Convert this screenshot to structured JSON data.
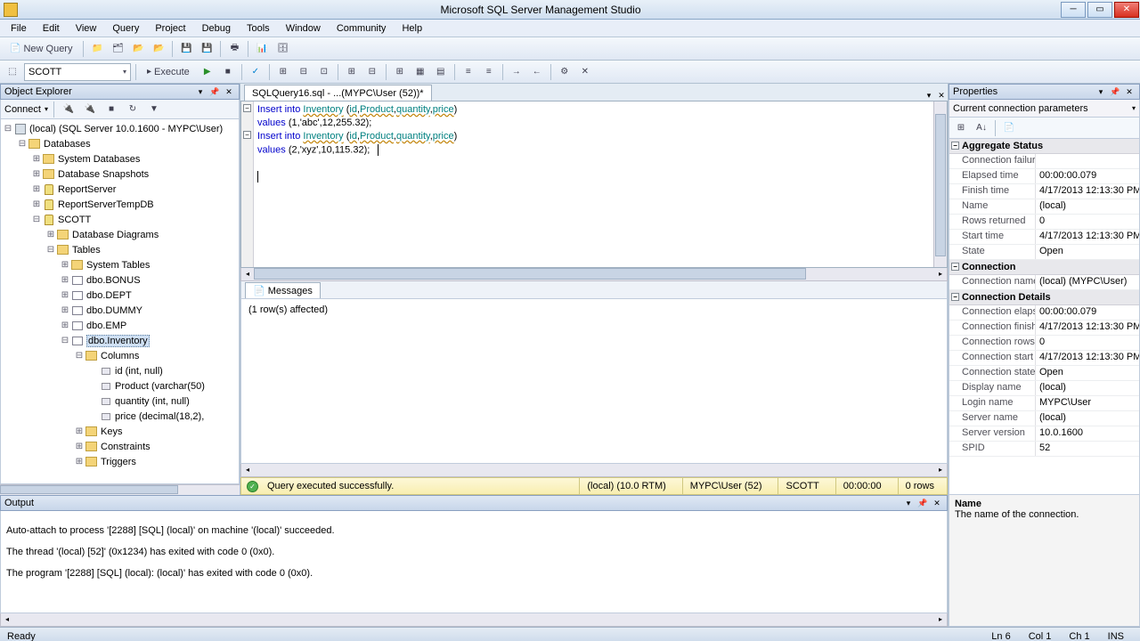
{
  "title": "Microsoft SQL Server Management Studio",
  "menu": [
    "File",
    "Edit",
    "View",
    "Query",
    "Project",
    "Debug",
    "Tools",
    "Window",
    "Community",
    "Help"
  ],
  "toolbar1": {
    "new_query": "New Query"
  },
  "toolbar2": {
    "db_combo": "SCOTT",
    "execute": "Execute"
  },
  "explorer": {
    "title": "Object Explorer",
    "connect_label": "Connect",
    "server": "(local) (SQL Server 10.0.1600 - MYPC\\User)",
    "databases": "Databases",
    "sysdb": "System Databases",
    "dbsnap": "Database Snapshots",
    "rs": "ReportServer",
    "rstmp": "ReportServerTempDB",
    "scott": "SCOTT",
    "diagrams": "Database Diagrams",
    "tables": "Tables",
    "systables": "System Tables",
    "bonus": "dbo.BONUS",
    "dept": "dbo.DEPT",
    "dummy": "dbo.DUMMY",
    "emp": "dbo.EMP",
    "inventory": "dbo.Inventory",
    "columns": "Columns",
    "col_id": "id (int, null)",
    "col_product": "Product (varchar(50)",
    "col_qty": "quantity (int, null)",
    "col_price": "price (decimal(18,2),",
    "keys": "Keys",
    "constraints": "Constraints",
    "triggers": "Triggers"
  },
  "editor": {
    "tab": "SQLQuery16.sql - ...(MYPC\\User (52))*",
    "lines": [
      {
        "kw1": "Insert",
        "kw2": "into",
        "tbl": "Inventory",
        "op": " (",
        "c1": "id",
        "c2": "Product",
        "c3": "quantity",
        "c4": "price",
        "cl": ")"
      },
      {
        "kw": "values",
        "rest": " (1,'abc',12,255.32);"
      },
      {
        "kw1": "Insert",
        "kw2": "into",
        "tbl": "Inventory",
        "op": " (",
        "c1": "id",
        "c2": "Product",
        "c3": "quantity",
        "c4": "price",
        "cl": ")"
      },
      {
        "kw": "values",
        "rest": " (2,'xyz',10,115.32);"
      }
    ]
  },
  "messages": {
    "tab": "Messages",
    "text": "(1 row(s) affected)"
  },
  "status": {
    "msg": "Query executed successfully.",
    "server": "(local) (10.0 RTM)",
    "user": "MYPC\\User (52)",
    "db": "SCOTT",
    "time": "00:00:00",
    "rows": "0 rows"
  },
  "props": {
    "title": "Properties",
    "subtitle": "Current connection parameters",
    "cat_agg": "Aggregate Status",
    "cat_conn": "Connection",
    "cat_det": "Connection Details",
    "rows_agg": [
      {
        "n": "Connection failure",
        "": ""
      },
      {
        "n": "Elapsed time",
        "v": "00:00:00.079"
      },
      {
        "n": "Finish time",
        "v": "4/17/2013 12:13:30 PM"
      },
      {
        "n": "Name",
        "v": "(local)"
      },
      {
        "n": "Rows returned",
        "v": "0"
      },
      {
        "n": "Start time",
        "v": "4/17/2013 12:13:30 PM"
      },
      {
        "n": "State",
        "v": "Open"
      }
    ],
    "rows_conn": [
      {
        "n": "Connection name",
        "v": "(local) (MYPC\\User)"
      }
    ],
    "rows_det": [
      {
        "n": "Connection elaps",
        "v": "00:00:00.079"
      },
      {
        "n": "Connection finish",
        "v": "4/17/2013 12:13:30 PM"
      },
      {
        "n": "Connection rows",
        "v": "0"
      },
      {
        "n": "Connection start t",
        "v": "4/17/2013 12:13:30 PM"
      },
      {
        "n": "Connection state",
        "v": "Open"
      },
      {
        "n": "Display name",
        "v": "(local)"
      },
      {
        "n": "Login name",
        "v": "MYPC\\User"
      },
      {
        "n": "Server name",
        "v": "(local)"
      },
      {
        "n": "Server version",
        "v": "10.0.1600"
      },
      {
        "n": "SPID",
        "v": "52"
      }
    ],
    "help_name": "Name",
    "help_text": "The name of the connection."
  },
  "output": {
    "title": "Output",
    "l1": "Auto-attach to process '[2288] [SQL] (local)' on machine '(local)' succeeded.",
    "l2": "The thread '(local) [52]' (0x1234) has exited with code 0 (0x0).",
    "l3": "The program '[2288] [SQL] (local): (local)' has exited with code 0 (0x0)."
  },
  "statusbar": {
    "ready": "Ready",
    "ln": "Ln 6",
    "col": "Col 1",
    "ch": "Ch 1",
    "ins": "INS"
  }
}
